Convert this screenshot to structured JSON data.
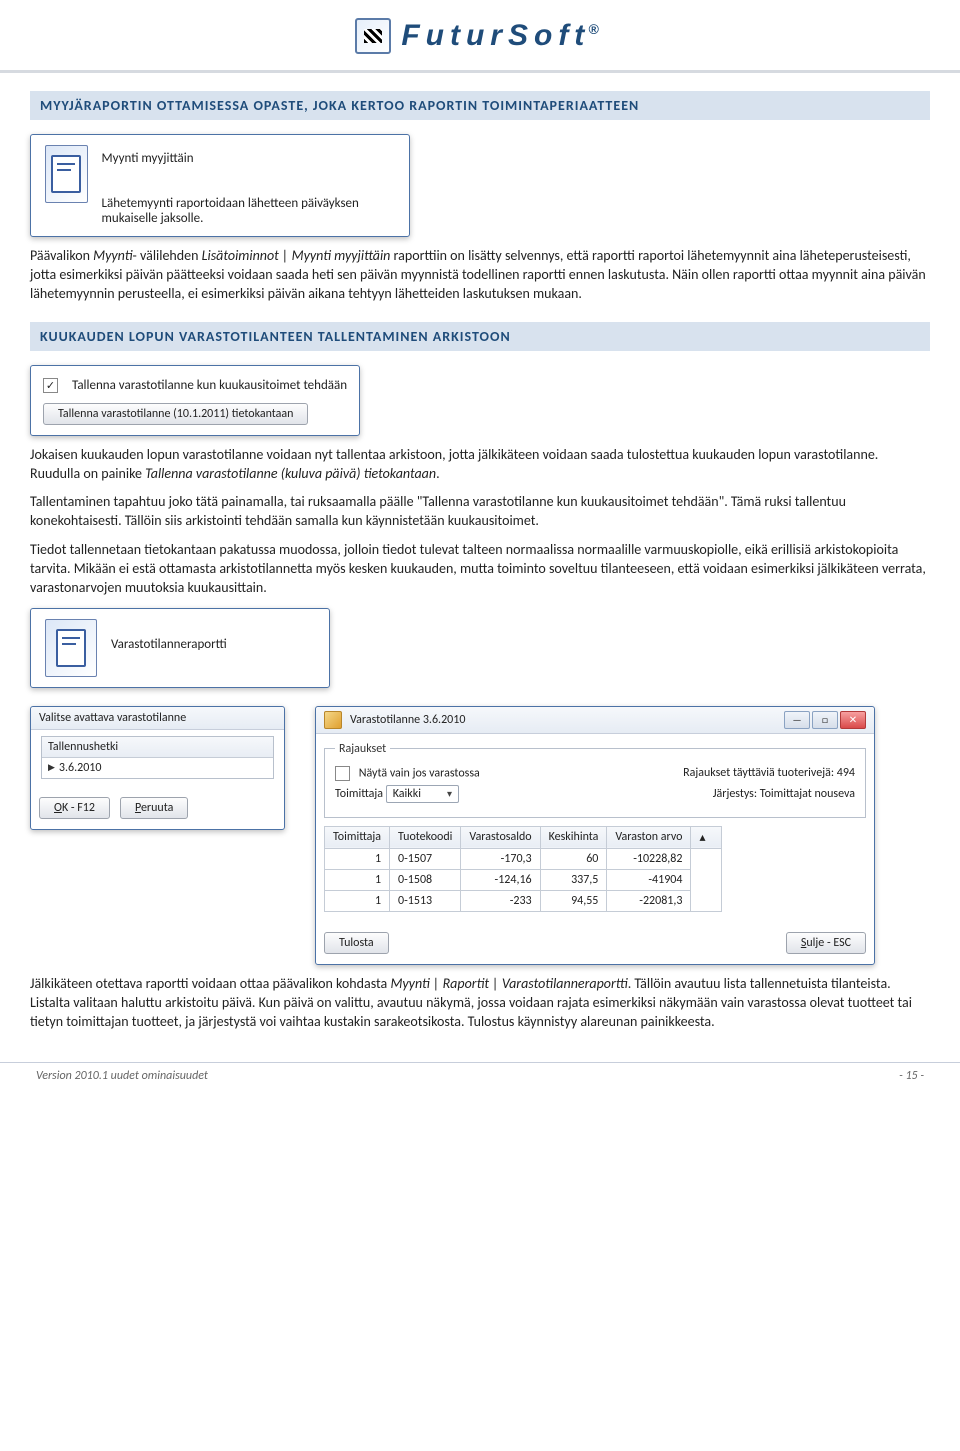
{
  "brand": {
    "name": "FuturSoft",
    "reg": "®"
  },
  "section1": {
    "title": "MYYJÄRAPORTIN OTTAMISESSA OPASTE, JOKA KERTOO RAPORTIN TOIMINTAPERIAATTEEN",
    "panel_title": "Myynti myyjittäin",
    "panel_desc": "Lähetemyynti raportoidaan lähetteen päiväyksen mukaiselle jaksolle.",
    "para1a": "Päävalikon ",
    "para1b": "Myynti",
    "para1c": "- välilehden ",
    "para1d": "Lisätoiminnot | Myynti myyjittäin",
    "para1e": " raporttiin on lisätty selvennys, että raportti raportoi lähetemyynnit aina läheteperusteisesti, jotta esimerkiksi päivän päätteeksi voidaan saada heti sen päivän myynnistä todellinen raportti ennen laskutusta. Näin ollen raportti ottaa myynnit aina päivän lähetemyynnin perusteella, ei esimerkiksi päivän aikana tehtyyn lähetteiden laskutuksen mukaan."
  },
  "section2": {
    "title": "KUUKAUDEN LOPUN VARASTOTILANTEEN TALLENTAMINEN ARKISTOON",
    "checkbox_label": "Tallenna varastotilanne kun kuukausitoimet tehdään",
    "button_label": "Tallenna varastotilanne (10.1.2011) tietokantaan",
    "p1a": "Jokaisen kuukauden lopun varastotilanne voidaan nyt tallentaa arkistoon, jotta jälkikäteen voidaan saada tulostettua kuukauden lopun varastotilanne. Ruudulla on painike ",
    "p1b": "Tallenna varastotilanne (kuluva päivä) tietokantaan",
    "p1c": ".",
    "p2": "Tallentaminen tapahtuu joko tätä painamalla, tai ruksaamalla päälle \"Tallenna varastotilanne kun kuukausitoimet tehdään\". Tämä ruksi tallentuu konekohtaisesti. Tällöin siis arkistointi tehdään samalla kun käynnistetään kuukausitoimet.",
    "p3": "Tiedot tallennetaan tietokantaan pakatussa muodossa, jolloin tiedot tulevat talteen normaalissa normaalille varmuuskopiolle, eikä erillisiä arkistokopioita tarvita. Mikään ei estä ottamasta arkistotilannetta myös kesken kuukauden, mutta toiminto soveltuu tilanteeseen, että voidaan esimerkiksi jälkikäteen verrata, varastonarvojen muutoksia kuukausittain.",
    "report_btn_label": "Varastotilanneraportti"
  },
  "select_dialog": {
    "title": "Valitse avattava varastotilanne",
    "col": "Tallennushetki",
    "row": "3.6.2010",
    "ok": "OK - F12",
    "cancel": "Peruuta"
  },
  "report_dialog": {
    "title": "Varastotilanne 3.6.2010",
    "legend": "Rajaukset",
    "only_stock": "Näytä vain jos varastossa",
    "supplier_label": "Toimittaja",
    "supplier_value": "Kaikki",
    "rows_label": "Rajaukset täyttäviä tuoterivejä: 494",
    "order_label": "Järjestys: Toimittajat nouseva",
    "cols": [
      "Toimittaja",
      "Tuotekoodi",
      "Varastosaldo",
      "Keskihinta",
      "Varaston arvo"
    ],
    "rows": [
      {
        "toimittaja": "1",
        "tuotekoodi": "0-1507",
        "saldo": "-170,3",
        "hinta": "60",
        "arvo": "-10228,82"
      },
      {
        "toimittaja": "1",
        "tuotekoodi": "0-1508",
        "saldo": "-124,16",
        "hinta": "337,5",
        "arvo": "-41904"
      },
      {
        "toimittaja": "1",
        "tuotekoodi": "0-1513",
        "saldo": "-233",
        "hinta": "94,55",
        "arvo": "-22081,3"
      }
    ],
    "print": "Tulosta",
    "close": "Sulje - ESC"
  },
  "para_after": {
    "a": "Jälkikäteen otettava raportti voidaan ottaa päävalikon kohdasta ",
    "b": "Myynti | Raportit | Varastotilanneraportti",
    "c": ". Tällöin avautuu lista tallennetuista tilanteista. Listalta valitaan haluttu arkistoitu päivä. Kun päivä on valittu, avautuu näkymä, jossa voidaan rajata esimerkiksi näkymään vain varastossa olevat tuotteet tai tietyn toimittajan tuotteet, ja järjestystä voi vaihtaa kustakin sarakeotsikosta. Tulostus käynnistyy alareunan painikkeesta."
  },
  "footer": {
    "left": "Version 2010.1 uudet ominaisuudet",
    "right": "- 15 -"
  }
}
